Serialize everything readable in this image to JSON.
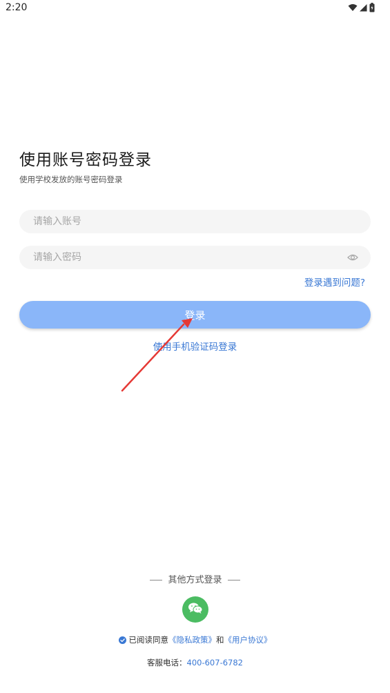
{
  "status_bar": {
    "time": "2:20",
    "icons": [
      "wifi-icon",
      "signal-icon",
      "battery-icon"
    ]
  },
  "login": {
    "title": "使用账号密码登录",
    "subtitle": "使用学校发放的账号密码登录",
    "account_placeholder": "请输入账号",
    "password_placeholder": "请输入密码",
    "account_value": "",
    "password_value": "",
    "help_link": "登录遇到问题?",
    "login_button": "登录",
    "sms_login_link": "使用手机验证码登录"
  },
  "other_login": {
    "title": "其他方式登录",
    "methods": [
      "wechat-icon"
    ]
  },
  "agreement": {
    "checked": true,
    "prefix": "已阅读同意",
    "privacy_link": "《隐私政策》",
    "and": "和",
    "user_agreement_link": "《用户协议》"
  },
  "support": {
    "label": "客服电话：",
    "phone": "400-607-6782"
  },
  "colors": {
    "accent": "#3a78d4",
    "button_bg": "#8ab6f9",
    "wechat_green": "#4bbc62",
    "arrow_red": "#e53935"
  }
}
